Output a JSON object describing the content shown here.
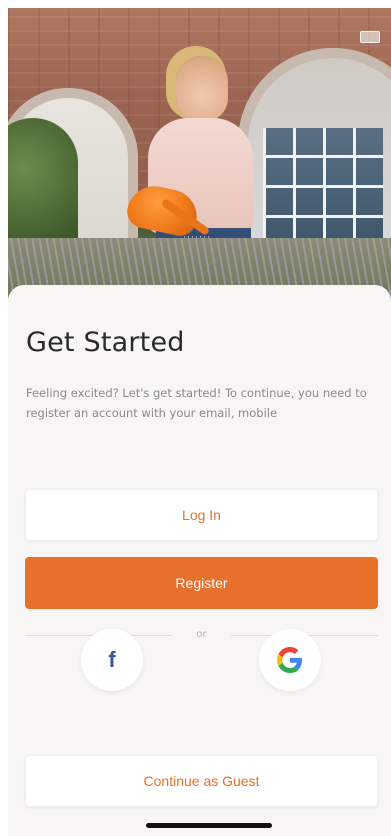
{
  "screen": {
    "title": "Get Started",
    "subtitle": "Feeling excited? Let's get started! To continue, you need to register an account with your email, mobile"
  },
  "buttons": {
    "login_label": "Log In",
    "register_label": "Register",
    "guest_label": "Continue as Guest"
  },
  "divider": {
    "text": "or"
  },
  "social": {
    "facebook_glyph": "f",
    "facebook_icon": "facebook-icon",
    "google_icon": "google-icon"
  },
  "hero": {
    "icon": "hero-photo"
  },
  "colors": {
    "accent": "#E7702C",
    "sheet_background": "#F7F6F4",
    "page_background": "#EBE8E3",
    "facebook_blue": "#3B5998",
    "google_blue": "#4285F4",
    "google_red": "#EA4335",
    "google_yellow": "#FBBC05",
    "google_green": "#34A853"
  }
}
